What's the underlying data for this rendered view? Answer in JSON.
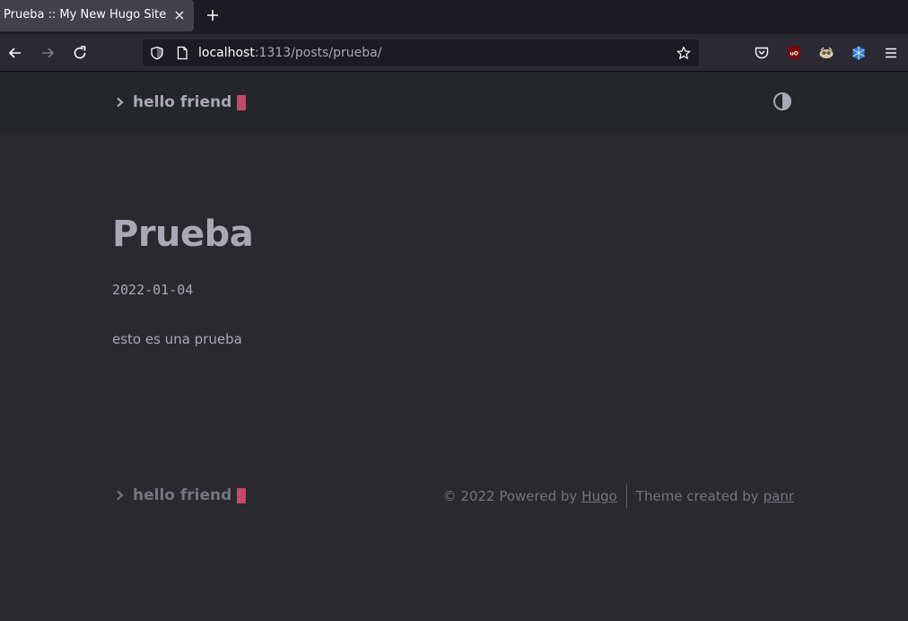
{
  "browser": {
    "tab_title": "Prueba :: My New Hugo Site",
    "url_host": "localhost",
    "url_rest": ":1313/posts/prueba/"
  },
  "site": {
    "logo_text": "hello friend",
    "accent_color": "#fe5186"
  },
  "post": {
    "title": "Prueba",
    "date": "2022-01-04",
    "content": "esto es una prueba"
  },
  "footer": {
    "logo_text": "hello friend",
    "powered_prefix": "© 2022 Powered by",
    "powered_link": "Hugo",
    "theme_prefix": "Theme created by",
    "theme_link": "panr"
  }
}
